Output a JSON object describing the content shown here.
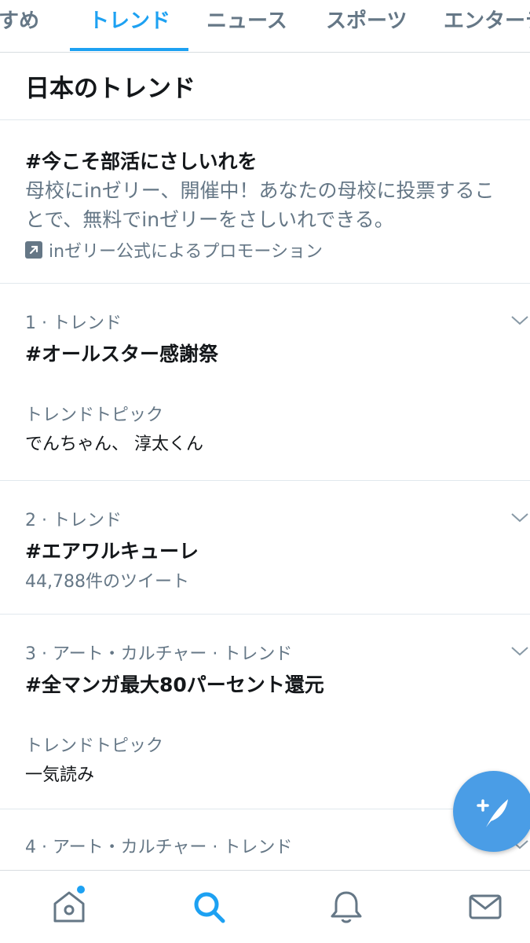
{
  "tabs": [
    {
      "label": "すめ"
    },
    {
      "label": "トレンド"
    },
    {
      "label": "ニュース"
    },
    {
      "label": "スポーツ"
    },
    {
      "label": "エンターテ"
    }
  ],
  "section_title": "日本のトレンド",
  "promoted": {
    "name": "#今こそ部活にさしいれを",
    "description": "母校にinゼリー、開催中！あなたの母校に投票することで、無料でinゼリーをさしいれできる。",
    "promo_text": "inゼリー公式によるプロモーション"
  },
  "trends": [
    {
      "meta": "1 · トレンド",
      "name": "#オールスター感謝祭",
      "topic_label": "トレンドトピック",
      "topic": "でんちゃん、 淳太くん"
    },
    {
      "meta": "2 · トレンド",
      "name": "#エアワルキューレ",
      "count": "44,788件のツイート"
    },
    {
      "meta": "3 · アート・カルチャー · トレンド",
      "name": "#全マンガ最大80パーセント還元",
      "topic_label": "トレンドトピック",
      "topic": "一気読み"
    },
    {
      "meta": "4 · アート・カルチャー · トレンド"
    }
  ],
  "colors": {
    "accent": "#1da1f2",
    "muted": "#657786",
    "text": "#14171a"
  },
  "icons": [
    "home-icon",
    "search-icon",
    "notifications-icon",
    "messages-icon",
    "compose-tweet-icon",
    "chevron-down-icon",
    "promoted-arrow-icon"
  ]
}
